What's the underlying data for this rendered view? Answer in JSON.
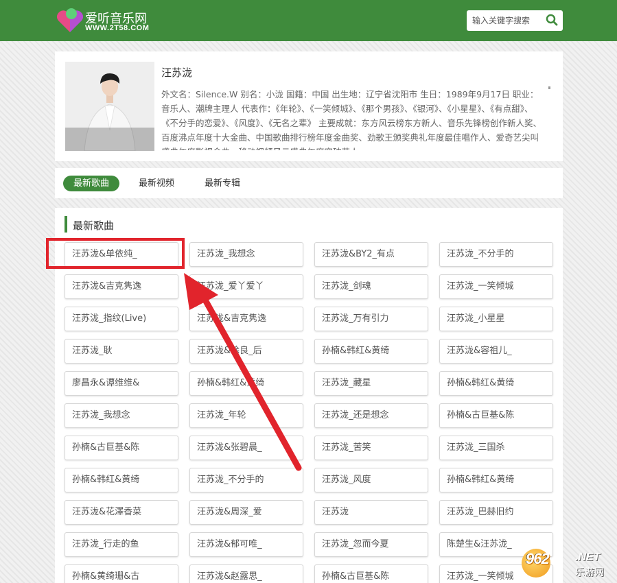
{
  "header": {
    "site_name": "爱听音乐网",
    "site_url": "WWW.2T58.COM",
    "search": {
      "placeholder": "输入关键字搜索",
      "icon": "search-icon"
    },
    "brand_color": "#3f8b3c"
  },
  "artist": {
    "name": "汪苏泷",
    "bio": "外文名：Silence.W 别名：小泷 国籍：中国 出生地：辽宁省沈阳市 生日：1989年9月17日 职业：音乐人、潮牌主理人 代表作：《年轮》、《一笑倾城》、《那个男孩》、《银河》、《小星星》、《有点甜》、《不分手的恋爱》、《风度》、《无名之辈》 主要成就：东方风云榜东方新人、音乐先锋榜创作新人奖、百度沸点年度十大金曲、中国歌曲排行榜年度金曲奖、劲歌王颁奖典礼年度最佳唱作人、爱奇艺尖叫盛典年度影视金曲、移动视频风云盛典年度突破艺人、"
  },
  "tabs": [
    {
      "label": "最新歌曲",
      "active": true
    },
    {
      "label": "最新视频",
      "active": false
    },
    {
      "label": "最新专辑",
      "active": false
    }
  ],
  "songs_section": {
    "title": "最新歌曲",
    "songs": [
      "汪苏泷&单依纯_",
      "汪苏泷_我想念",
      "汪苏泷&BY2_有点",
      "汪苏泷_不分手的",
      "汪苏泷&吉克隽逸",
      "汪苏泷_爱丫爱丫",
      "汪苏泷_剑魂",
      "汪苏泷_一笑倾城",
      "汪苏泷_指纹(Live)",
      "汪苏泷&吉克隽逸",
      "汪苏泷_万有引力",
      "汪苏泷_小星星",
      "汪苏泷_耿",
      "汪苏泷&徐良_后",
      "孙楠&韩红&黄绮",
      "汪苏泷&容祖儿_",
      "廖昌永&谭维维&",
      "孙楠&韩红&黄绮",
      "汪苏泷_藏星",
      "孙楠&韩红&黄绮",
      "汪苏泷_我想念",
      "汪苏泷_年轮",
      "汪苏泷_还是想念",
      "孙楠&古巨基&陈",
      "孙楠&古巨基&陈",
      "汪苏泷&张碧晨_",
      "汪苏泷_苦笑",
      "汪苏泷_三国杀",
      "孙楠&韩红&黄绮",
      "汪苏泷_不分手的",
      "汪苏泷_风度",
      "孙楠&韩红&黄绮",
      "汪苏泷&花澤香菜",
      "汪苏泷&周深_爱",
      "汪苏泷",
      "汪苏泷_巴赫旧约",
      "汪苏泷_行走的鱼",
      "汪苏泷&郁可唯_",
      "汪苏泷_忽而今夏",
      "陈楚生&汪苏泷_",
      "孙楠&黄绮珊&古",
      "汪苏泷&赵露思_",
      "孙楠&古巨基&陈",
      "汪苏泷_一笑倾城"
    ]
  },
  "annotation": {
    "highlight_color": "#e1242c"
  },
  "watermark": {
    "number": "962",
    "domain": ".NET",
    "cn_text": "乐游网"
  }
}
